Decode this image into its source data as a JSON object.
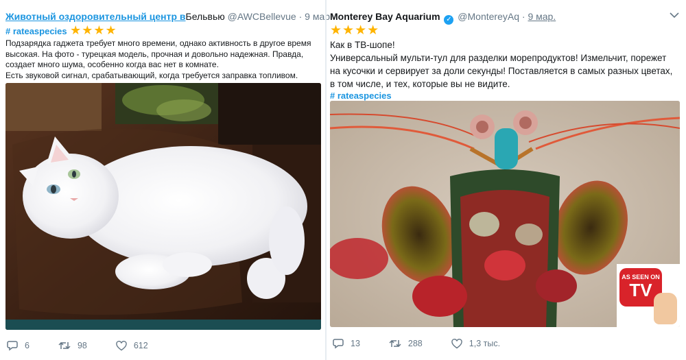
{
  "tweet1": {
    "name": "Животный оздоровительный центр в",
    "name_rest": "Бельвью",
    "handle": "@AWCBellevue",
    "dot": "·",
    "time": "9 мар.",
    "hashtag": "# rateaspecies",
    "stars": "★★★★",
    "text_lines": [
      "Подзарядка гаджета требует много времени, однако активность в другое время",
      "высокая. На фото - турецкая модель, прочная и довольно надежная. Правда,",
      "создает много шума, особенно когда вас нет в комнате.",
      "Есть звуковой сигнал, срабатывающий, когда требуется заправка топливом."
    ],
    "replies": "6",
    "retweets": "98",
    "likes": "612"
  },
  "tweet2": {
    "name": "Monterey Bay Aquarium",
    "handle": "@MontereyAq",
    "dot": "·",
    "time": "9 мар.",
    "stars": "★★★★",
    "text_lines": [
      "Как в ТВ-шопе!",
      "Универсальный мульти-тул для разделки морепродуктов! Измельчит, порежет",
      "на кусочки и сервирует за доли секунды! Поставляется в самых разных цветах,",
      "в том числе, и тех, которые вы не видите."
    ],
    "hashtag": "# rateaspecies",
    "badge_top": "AS SEEN ON",
    "badge_tv": "TV",
    "replies": "13",
    "retweets": "288",
    "likes": "1,3 тыс."
  },
  "colors": {
    "link": "#1b95e0",
    "star": "#ffb400",
    "muted": "#657786",
    "verified": "#1da1f2"
  },
  "icons": [
    "reply-icon",
    "retweet-icon",
    "like-icon",
    "verified-icon",
    "chevron-down-icon"
  ]
}
